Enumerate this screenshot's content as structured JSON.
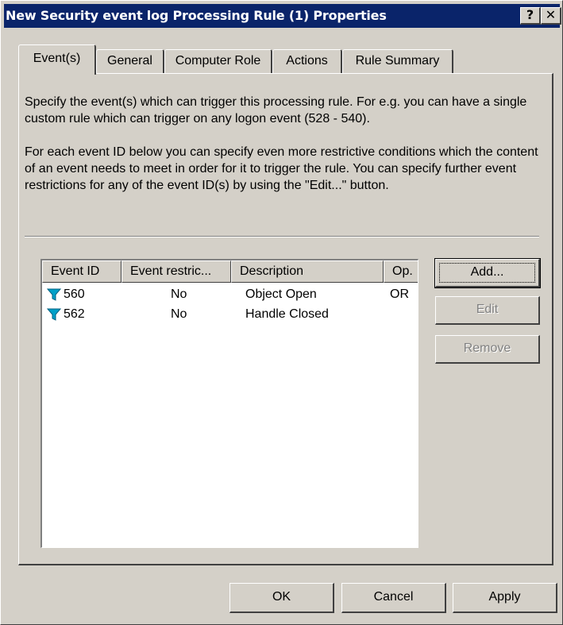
{
  "window": {
    "title": "New Security event log Processing Rule (1) Properties",
    "help_glyph": "?",
    "close_glyph": "✕"
  },
  "tabs": [
    {
      "label": "Event(s)",
      "active": true
    },
    {
      "label": "General",
      "active": false
    },
    {
      "label": "Computer Role",
      "active": false
    },
    {
      "label": "Actions",
      "active": false
    },
    {
      "label": "Rule Summary",
      "active": false
    }
  ],
  "description": {
    "para1": "Specify the event(s) which can trigger this processing rule. For e.g. you can have a single custom rule which can trigger on any logon event (528 - 540).",
    "para2": "For each event ID below you can specify even more restrictive conditions which the content of an event needs to meet in order for it to trigger the rule. You can specify further event restrictions for any of the event ID(s) by using the \"Edit...\" button."
  },
  "list": {
    "columns": [
      "Event ID",
      "Event restric...",
      "Description",
      "Op."
    ],
    "rows": [
      {
        "event_id": "560",
        "restriction": "No",
        "description": "Object Open",
        "op": "OR"
      },
      {
        "event_id": "562",
        "restriction": "No",
        "description": "Handle Closed",
        "op": ""
      }
    ],
    "icon": "filter-icon",
    "icon_color": "#00a0c8"
  },
  "side_buttons": {
    "add": "Add...",
    "edit": "Edit",
    "remove": "Remove"
  },
  "footer": {
    "ok": "OK",
    "cancel": "Cancel",
    "apply": "Apply"
  },
  "colors": {
    "titlebar": "#0a246a",
    "face": "#d4d0c8"
  }
}
